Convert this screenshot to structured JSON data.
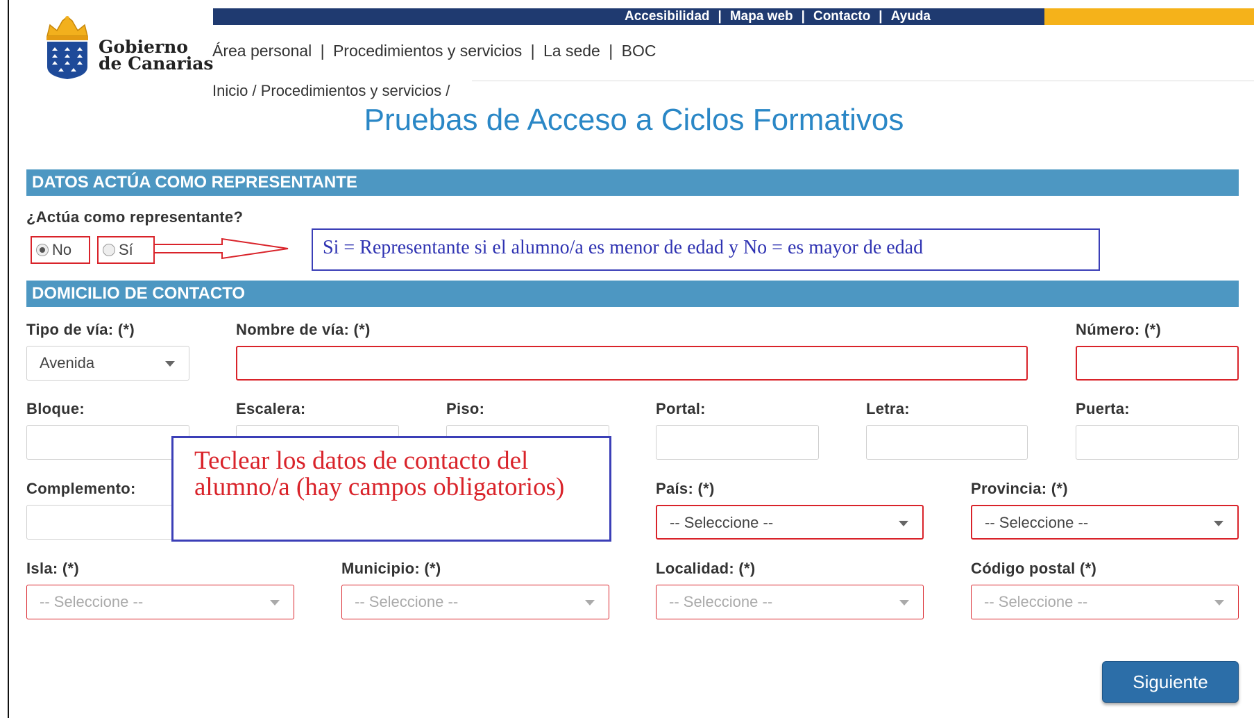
{
  "top_links": [
    "Accesibilidad",
    "Mapa web",
    "Contacto",
    "Ayuda"
  ],
  "top_link_separator": "|",
  "brand": {
    "line1": "Gobierno",
    "line2": "de Canarias"
  },
  "main_nav": [
    "Área personal",
    "Procedimientos y servicios",
    "La sede",
    "BOC"
  ],
  "main_nav_separator": "|",
  "breadcrumb": "Inicio / Procedimientos y servicios /",
  "page_title": "Pruebas de Acceso a Ciclos Formativos",
  "section_representante": {
    "header": "DATOS ACTÚA COMO REPRESENTANTE",
    "question": "¿Actúa como representante?",
    "options": [
      {
        "label": "No",
        "checked": true
      },
      {
        "label": "Sí",
        "checked": false
      }
    ],
    "annotation": "Si = Representante si el alumno/a es menor de edad y No = es mayor de edad"
  },
  "section_domicilio": {
    "header": "DOMICILIO DE CONTACTO",
    "tipo_via": {
      "label": "Tipo de vía: (*)",
      "value": "Avenida"
    },
    "nombre_via": {
      "label": "Nombre de vía: (*)",
      "value": ""
    },
    "numero": {
      "label": "Número: (*)",
      "value": ""
    },
    "bloque": {
      "label": "Bloque:",
      "value": ""
    },
    "escalera": {
      "label": "Escalera:",
      "value": ""
    },
    "piso": {
      "label": "Piso:",
      "value": ""
    },
    "portal": {
      "label": "Portal:",
      "value": ""
    },
    "letra": {
      "label": "Letra:",
      "value": ""
    },
    "puerta": {
      "label": "Puerta:",
      "value": ""
    },
    "complemento": {
      "label": "Complemento:",
      "value": ""
    },
    "pais": {
      "label": "País: (*)",
      "value": "-- Seleccione --"
    },
    "provincia": {
      "label": "Provincia: (*)",
      "value": "-- Seleccione --"
    },
    "isla": {
      "label": "Isla: (*)",
      "value": "-- Seleccione --"
    },
    "municipio": {
      "label": "Municipio: (*)",
      "value": "-- Seleccione --"
    },
    "localidad": {
      "label": "Localidad: (*)",
      "value": "-- Seleccione --"
    },
    "codigo_postal": {
      "label": "Código postal (*)",
      "value": "-- Seleccione --"
    },
    "annotation": "Teclear los datos de contacto del alumno/a (hay campos obligatorios)"
  },
  "next_button": "Siguiente",
  "colors": {
    "navy_bar": "#1f3a70",
    "gold_bar": "#f5b21a",
    "section_blue": "#4d97c2",
    "title_blue": "#2a87c6",
    "required_red": "#d9232a",
    "annotation_blue": "#3b3fb7"
  }
}
